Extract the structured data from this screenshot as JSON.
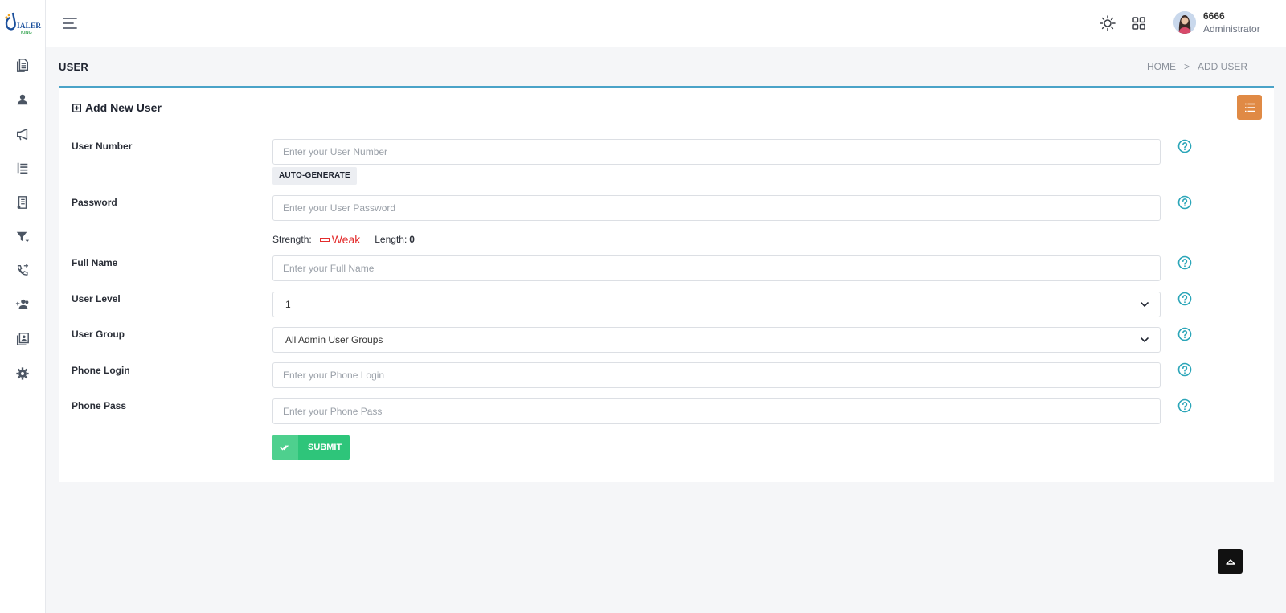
{
  "brand": {
    "logo_text": "DIALER KING"
  },
  "header": {
    "user_name": "6666",
    "user_role": "Administrator"
  },
  "page": {
    "title": "USER",
    "breadcrumb": {
      "home": "HOME",
      "separator": ">",
      "current": "ADD USER"
    }
  },
  "card": {
    "title": "Add New User"
  },
  "form": {
    "user_number": {
      "label": "User Number",
      "placeholder": "Enter your User Number"
    },
    "auto_generate_label": "AUTO-GENERATE",
    "password": {
      "label": "Password",
      "placeholder": "Enter your User Password"
    },
    "strength": {
      "label": "Strength:",
      "value": "Weak",
      "length_label": "Length:",
      "length_value": "0"
    },
    "full_name": {
      "label": "Full Name",
      "placeholder": "Enter your Full Name"
    },
    "user_level": {
      "label": "User Level",
      "value": "1"
    },
    "user_group": {
      "label": "User Group",
      "value": "All Admin User Groups"
    },
    "phone_login": {
      "label": "Phone Login",
      "placeholder": "Enter your Phone Login"
    },
    "phone_pass": {
      "label": "Phone Pass",
      "placeholder": "Enter your Phone Pass"
    },
    "submit_label": "SUBMIT"
  },
  "colors": {
    "accent": "#4aa3c8",
    "list_button": "#e08a45",
    "submit": "#2ec57a",
    "weak": "#e32d2d",
    "help_icon": "#2aa5b8"
  },
  "sidebar_icons": [
    "document-icon",
    "user-icon",
    "megaphone-icon",
    "list-icon",
    "report-icon",
    "filter-icon",
    "phone-forward-icon",
    "users-add-icon",
    "contacts-icon",
    "gear-icon"
  ]
}
